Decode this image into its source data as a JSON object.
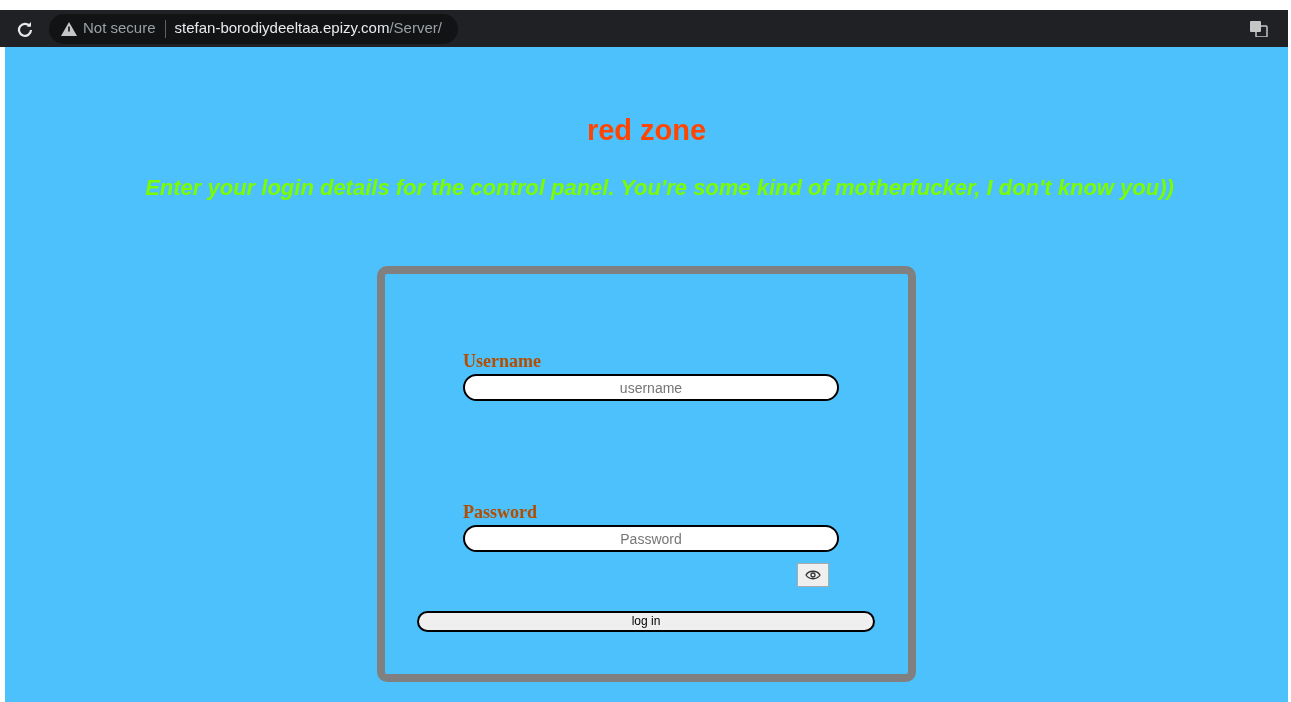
{
  "browser": {
    "security": "Not secure",
    "url_host": "stefan-borodiydeeltaa.epizy.com",
    "url_path": "/Server/"
  },
  "page": {
    "title": "red zone",
    "subtitle": "Enter your login details for the control panel. You're some kind of motherfucker, I don't know you))"
  },
  "login_form": {
    "username_label": "Username",
    "username_placeholder": "username",
    "password_label": "Password",
    "password_placeholder": "Password",
    "submit": "log in"
  }
}
